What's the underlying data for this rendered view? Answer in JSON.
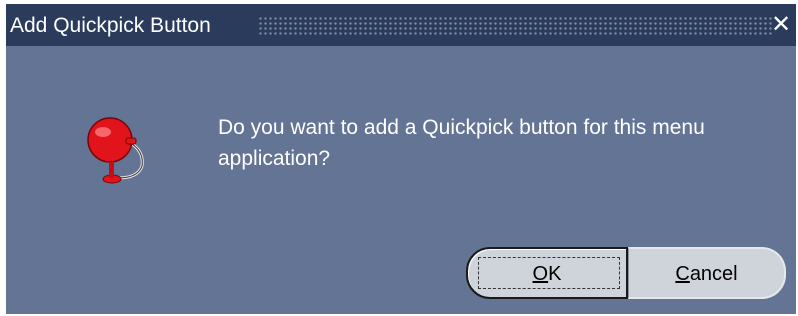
{
  "window": {
    "title": "Add Quickpick Button",
    "close_icon": "close-icon",
    "colors": {
      "titlebar": "#2a3b5b",
      "body": "#647494",
      "button_face": "#cfd3da",
      "text": "#ffffff"
    }
  },
  "content": {
    "icon": "bell-icon",
    "message": "Do you want to add a Quickpick button for this menu application?"
  },
  "buttons": {
    "ok": {
      "mnemonic": "O",
      "rest": "K"
    },
    "cancel": {
      "mnemonic": "C",
      "rest": "ancel"
    }
  }
}
